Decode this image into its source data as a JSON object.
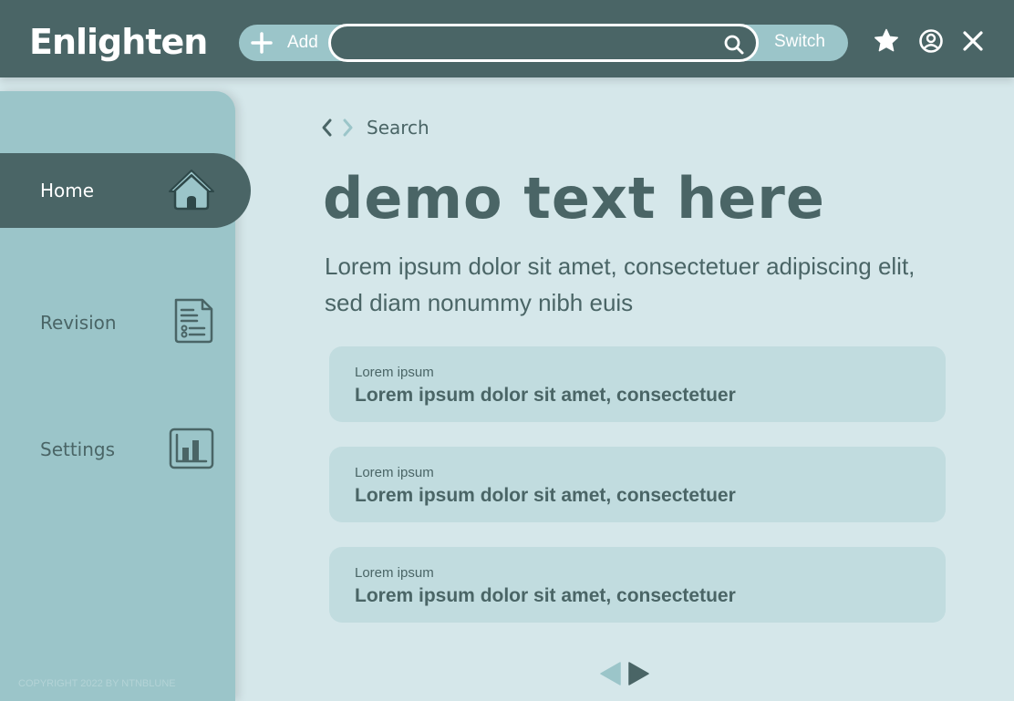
{
  "app": {
    "title": "Enlighten"
  },
  "topbar": {
    "add_label": "Add",
    "search": {
      "value": "",
      "placeholder": ""
    },
    "switch_label": "Switch",
    "icons": [
      "plus-icon",
      "search-icon",
      "star-icon",
      "user-icon",
      "close-icon"
    ]
  },
  "sidebar": {
    "items": [
      {
        "label": "Home",
        "icon": "home-icon",
        "active": true
      },
      {
        "label": "Revision",
        "icon": "document-list-icon",
        "active": false
      },
      {
        "label": "Settings",
        "icon": "bar-chart-icon",
        "active": false
      }
    ],
    "copyright": "COPYRIGHT 2022 BY NTNBLUNE"
  },
  "breadcrumb": {
    "label": "Search"
  },
  "main": {
    "title": "demo text here",
    "intro": "Lorem ipsum dolor sit amet, consectetuer adipiscing elit, sed diam nonummy nibh euis",
    "cards": [
      {
        "subtitle": "Lorem ipsum",
        "text": "Lorem ipsum dolor sit amet, consectetuer"
      },
      {
        "subtitle": "Lorem ipsum",
        "text": "Lorem ipsum dolor sit amet, consectetuer"
      },
      {
        "subtitle": "Lorem ipsum",
        "text": "Lorem ipsum dolor sit amet, consectetuer"
      }
    ]
  },
  "colors": {
    "primary": "#4a6566",
    "sidebar": "#9bc5c9",
    "background": "#d5e7ea",
    "card": "#c1dcdf",
    "white": "#ffffff"
  }
}
